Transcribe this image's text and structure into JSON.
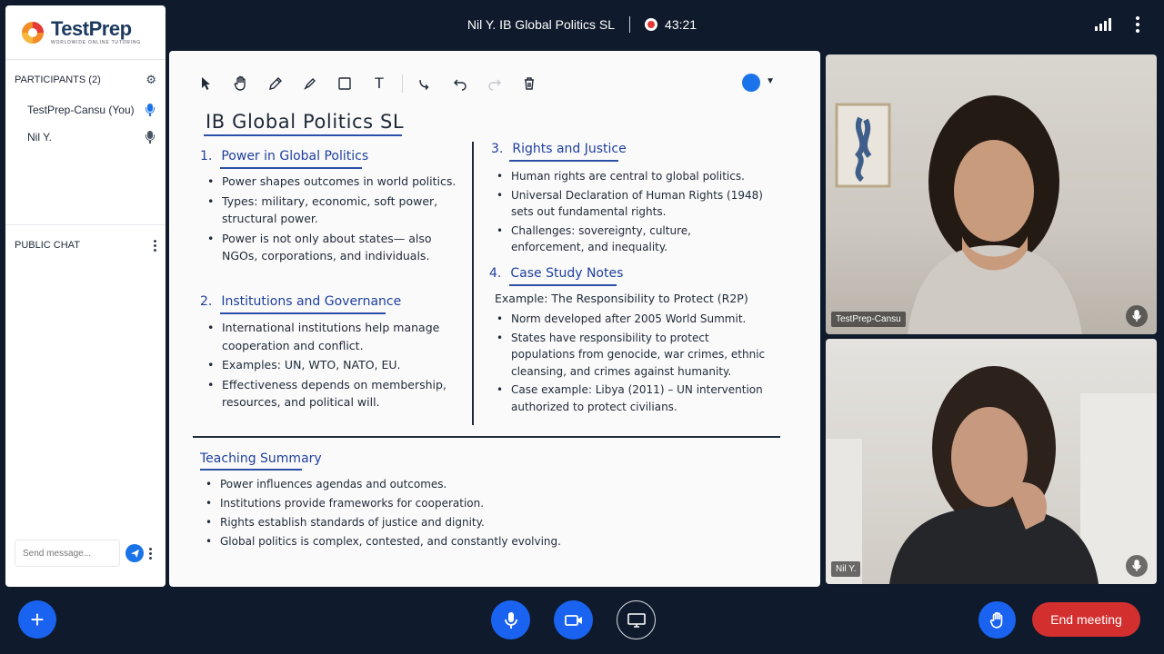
{
  "header": {
    "meeting_title": "Nil Y. IB Global Politics SL",
    "recording_timer": "43:21",
    "icons": [
      "signal-icon",
      "more-vertical-icon",
      "record-icon"
    ]
  },
  "sidebar": {
    "logo_text": "TestPrep",
    "logo_tagline": "WORLDWIDE ONLINE TUTORING",
    "participants_label": "PARTICIPANTS (2)",
    "participants": [
      {
        "name": "TestPrep-Cansu (You)",
        "mic_color": "#1a73e8"
      },
      {
        "name": "Nil Y.",
        "mic_color": "#4b5563"
      }
    ],
    "chat_label": "PUBLIC CHAT",
    "chat_placeholder": "Send message..."
  },
  "whiteboard": {
    "title": "IB Global Politics SL",
    "accent_color": "#1a73e8",
    "sections": [
      {
        "num": "1.",
        "heading": "Power in Global Politics",
        "bullets": [
          "Power shapes outcomes in world politics.",
          "Types: military, economic, soft power, structural power.",
          "Power is not only about states— also NGOs, corporations, and individuals."
        ]
      },
      {
        "num": "2.",
        "heading": "Institutions and Governance",
        "bullets": [
          "International institutions help manage cooperation and conflict.",
          "Examples: UN, WTO, NATO, EU.",
          "Effectiveness depends on membership, resources, and political will."
        ]
      },
      {
        "num": "3.",
        "heading": "Rights and Justice",
        "bullets": [
          "Human rights are central to global politics.",
          "Universal Declaration of Human Rights (1948) sets out fundamental rights.",
          "Challenges: sovereignty, culture, enforcement, and inequality."
        ]
      },
      {
        "num": "4.",
        "heading": "Case Study Notes",
        "example": "Example: The Responsibility to Protect (R2P)",
        "bullets": [
          "Norm developed after 2005 World Summit.",
          "States have responsibility to protect populations from genocide, war crimes, ethnic cleansing, and crimes against humanity.",
          "Case example: Libya (2011) – UN intervention authorized to protect civilians."
        ]
      }
    ],
    "summary": {
      "heading": "Teaching Summary",
      "bullets": [
        "Power influences agendas and outcomes.",
        "Institutions provide frameworks for cooperation.",
        "Rights establish standards of justice and dignity.",
        "Global politics is complex, contested, and constantly evolving."
      ]
    }
  },
  "videos": [
    {
      "name": "TestPrep-Cansu"
    },
    {
      "name": "Nil Y."
    }
  ],
  "controls": {
    "end_meeting_label": "End meeting",
    "add_label": "+"
  }
}
